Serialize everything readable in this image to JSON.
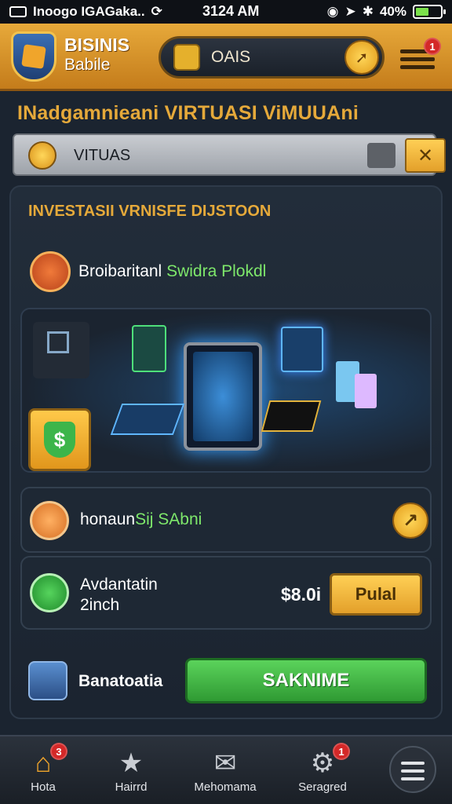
{
  "status_bar": {
    "left_text": "Inoogo IGAGaka..",
    "time": "3124 AM",
    "battery": "40%"
  },
  "header": {
    "brand_line1": "BISINIS",
    "brand_line2": "Babile",
    "coin_label": "OAIS",
    "menu_badge": "1"
  },
  "section": {
    "title": "INadgamnieani VIRTUASI ViMUUAni",
    "search_label": "VITUAS"
  },
  "panel": {
    "title": "INVESTASII VRNISFE DIJSTOON",
    "row1_label_white": "Broibaritanl ",
    "row1_label_green": "Swidra Plokdl",
    "row2_label_white": "honaun",
    "row2_label_green": "Sij SAbni",
    "row3_line1": "Avdantatin",
    "row3_line2": "2inch",
    "row3_price": "$8.0i",
    "row3_button": "Pulal",
    "row4_label": "Banatoatia",
    "row4_button": "SAKNIME"
  },
  "bottom_nav": {
    "items": [
      {
        "label": "Hota",
        "icon": "home-icon",
        "badge": "3"
      },
      {
        "label": "Hairrd",
        "icon": "star-icon"
      },
      {
        "label": "Mehomama",
        "icon": "document-icon"
      },
      {
        "label": "Seragred",
        "icon": "gear-icon",
        "badge": "1"
      }
    ]
  },
  "colors": {
    "accent_gold": "#e5a93a",
    "header_gold": "#e7a93a",
    "green": "#5bd35b",
    "badge_red": "#d42828"
  }
}
